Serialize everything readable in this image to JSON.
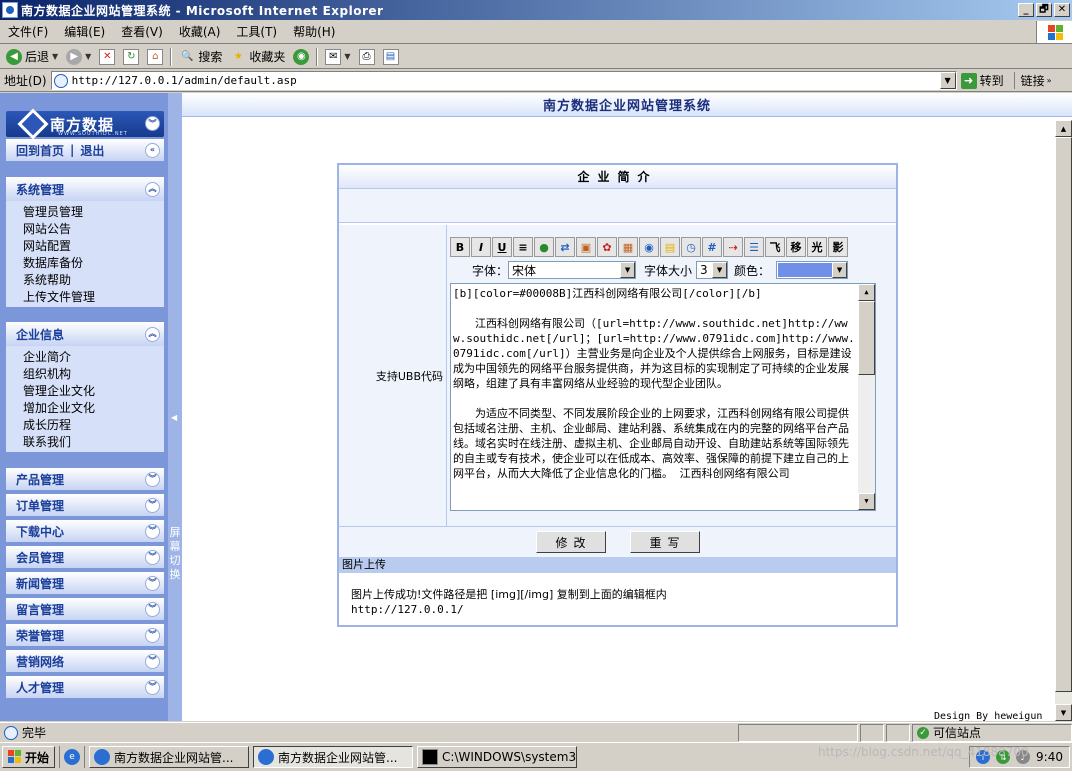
{
  "window": {
    "title": "南方数据企业网站管理系统 - Microsoft Internet Explorer",
    "buttons": [
      "_",
      "🗗",
      "✕"
    ]
  },
  "menu": [
    "文件(F)",
    "编辑(E)",
    "查看(V)",
    "收藏(A)",
    "工具(T)",
    "帮助(H)"
  ],
  "toolbar": {
    "back": "后退",
    "search": "搜索",
    "favorites": "收藏夹"
  },
  "address": {
    "label": "地址(D)",
    "url": "http://127.0.0.1/admin/default.asp",
    "go": "转到",
    "links": "链接"
  },
  "sidebar": {
    "logo_text": "南方数据",
    "logo_sub": "WWW.SOUTHIDC.NET",
    "home": "回到首页",
    "divider": "|",
    "logout": "退出",
    "sections": [
      {
        "title": "系统管理",
        "items": [
          "管理员管理",
          "网站公告",
          "网站配置",
          "数据库备份",
          "系统帮助",
          "上传文件管理"
        ]
      },
      {
        "title": "企业信息",
        "items": [
          "企业简介",
          "组织机构",
          "管理企业文化",
          "增加企业文化",
          "成长历程",
          "联系我们"
        ]
      }
    ],
    "closed": [
      "产品管理",
      "订单管理",
      "下载中心",
      "会员管理",
      "新闻管理",
      "留言管理",
      "荣誉管理",
      "营销网络",
      "人才管理"
    ],
    "toggle_label": "屏幕切换"
  },
  "main": {
    "header": "南方数据企业网站管理系统",
    "panel_title": "企业简介",
    "editor_label": "支持UBB代码",
    "ubb_buttons": [
      "B",
      "I",
      "U",
      "≡",
      "●",
      "⇄",
      "▣",
      "✿",
      "▦",
      "◉",
      "▤",
      "◷",
      "#",
      "⇢",
      "☰",
      "飞",
      "移",
      "光",
      "影"
    ],
    "font_label": "字体：",
    "font_value": "宋体",
    "size_label": "字体大小",
    "size_value": "3",
    "color_label": "颜色：",
    "color_value": "#6f8fe8",
    "content": [
      "[b][color=#00008B]江西科创网络有限公司[/color][/b]",
      "",
      "　　江西科创网络有限公司（[url=http://www.southidc.net]http://www.southidc.net[/url]；[url=http://www.0791idc.com]http://www.0791idc.com[/url]）主营业务是向企业及个人提供综合上网服务，目标是建设成为中国领先的网络平台服务提供商，并为这目标的实现制定了可持续的企业发展纲略，组建了具有丰富网络从业经验的现代型企业团队。",
      "",
      "　　为适应不同类型、不同发展阶段企业的上网要求，江西科创网络有限公司提供包括域名注册、主机、企业邮局、建站利器、系统集成在内的完整的网络平台产品线。域名实时在线注册、虚拟主机、企业邮局自动开设、自助建站系统等国际领先的自主或专有技术，使企业可以在低成本、高效率、强保障的前提下建立自己的上网平台，从而大大降低了企业信息化的门槛。 江西科创网络有限公司"
    ],
    "submit": "修改",
    "reset": "重写",
    "upload_head": "图片上传",
    "upload_msg": "图片上传成功!文件路径是把 [img][/img] 复制到上面的编辑框内",
    "upload_url": "http://127.0.0.1/",
    "design_by": "Design By heweigun"
  },
  "status": {
    "text": "完毕",
    "zone": "可信站点"
  },
  "taskbar": {
    "start": "开始",
    "tasks": [
      "南方数据企业网站管...",
      "南方数据企业网站管...",
      "C:\\WINDOWS\\system32..."
    ],
    "clock": "9:40",
    "watermark": "https://blog.csdn.net/qq_41888700"
  },
  "colors": {
    "sidebar": "#7b97d9",
    "title_bar": "#0a246a",
    "panel_border": "#9fb4e6",
    "header_text": "#1a2e7a"
  }
}
